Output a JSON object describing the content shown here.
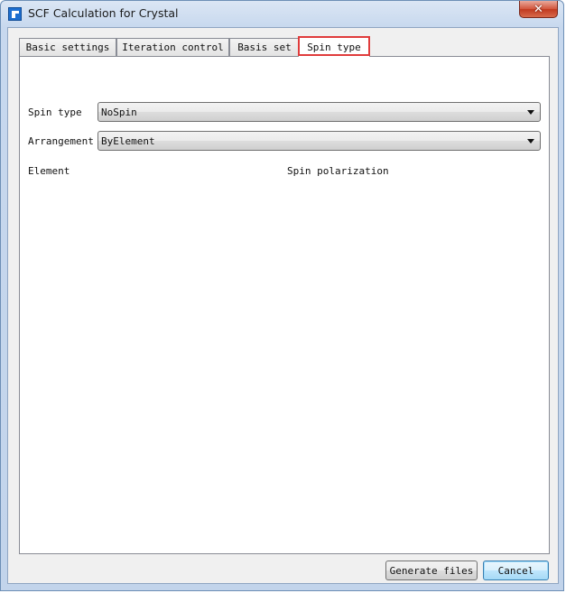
{
  "window": {
    "title": "SCF Calculation for Crystal",
    "app_icon": "app-icon",
    "close_glyph": "✕"
  },
  "tabs": [
    {
      "label": "Basic settings",
      "active": false
    },
    {
      "label": "Iteration control",
      "active": false
    },
    {
      "label": "Basis set",
      "active": false
    },
    {
      "label": "Spin type",
      "active": true
    }
  ],
  "spin_panel": {
    "spin_type_label": "Spin type",
    "spin_type_value": "NoSpin",
    "arrangement_label": "Arrangement",
    "arrangement_value": "ByElement",
    "table_header_element": "Element",
    "table_header_spin": "Spin polarization"
  },
  "buttons": {
    "generate": "Generate files",
    "cancel": "Cancel"
  },
  "colors": {
    "highlight": "#e03c3c",
    "default_button_border": "#3c7fb1"
  }
}
